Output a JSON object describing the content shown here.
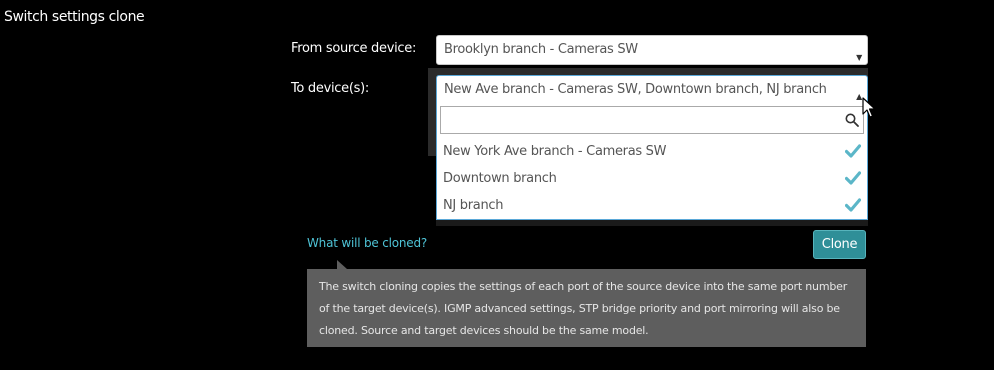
{
  "page": {
    "title": "Switch settings clone"
  },
  "form": {
    "from_label": "From source device:",
    "from_value": "Brooklyn branch - Cameras SW",
    "to_label": "To device(s):",
    "to_value": "New Ave branch - Cameras SW, Downtown branch, NJ branch"
  },
  "dropdown": {
    "search_value": "",
    "search_icon": "search-icon",
    "options": [
      {
        "label": "New York Ave branch - Cameras SW",
        "checked": true
      },
      {
        "label": "Downtown branch",
        "checked": true
      },
      {
        "label": "NJ branch",
        "checked": true
      }
    ]
  },
  "actions": {
    "what_link": "What will be cloned?",
    "clone_label": "Clone"
  },
  "tooltip": {
    "text": "The switch cloning copies the settings of each port of the source device into the same port number of the target device(s). IGMP advanced settings, STP bridge priority and port mirroring will also be cloned. Source and target devices should be the same model."
  },
  "colors": {
    "background": "#000000",
    "accent_link": "#4ec3d6",
    "button": "#2f8f98",
    "check": "#5bb6c8",
    "focus_border": "#5aa8d8",
    "tooltip_bg": "#5e5e5e"
  }
}
